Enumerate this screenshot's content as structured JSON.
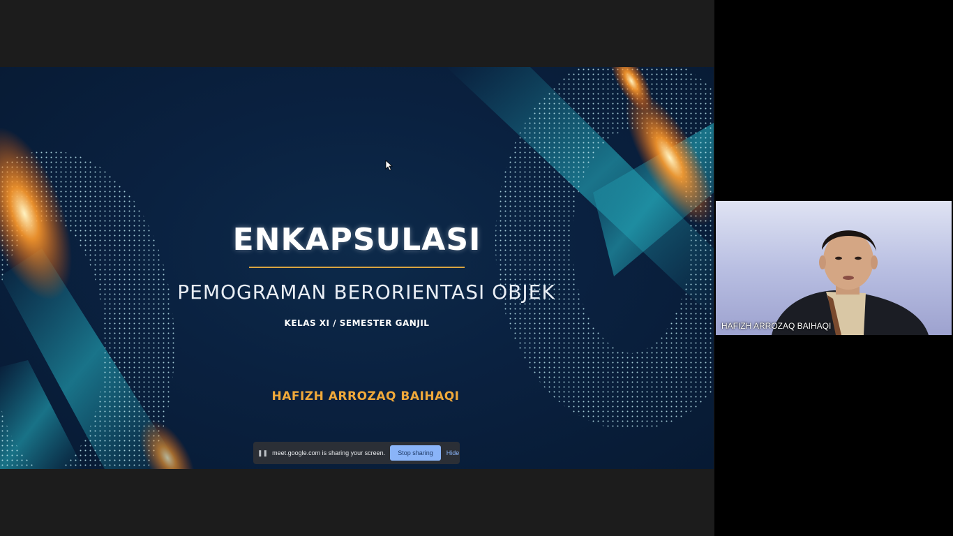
{
  "slide": {
    "title": "ENKAPSULASI",
    "subtitle": "PEMOGRAMAN BERORIENTASI OBJEK",
    "kelas": "KELAS XI / SEMESTER GANJIL",
    "author": "HAFIZH ARROZAQ BAIHAQI",
    "colors": {
      "background": "#0a2140",
      "accent_gold": "#d9a441",
      "author": "#f0a93a",
      "particles": "#8fd6e6",
      "flare": "#ff7a1a"
    }
  },
  "share_bar": {
    "grip_icon": "pause-grip-icon",
    "message": "meet.google.com is sharing your screen.",
    "stop_label": "Stop sharing",
    "hide_label": "Hide"
  },
  "participant": {
    "name": "HAFIZH ARROZAQ BAIHAQI"
  }
}
